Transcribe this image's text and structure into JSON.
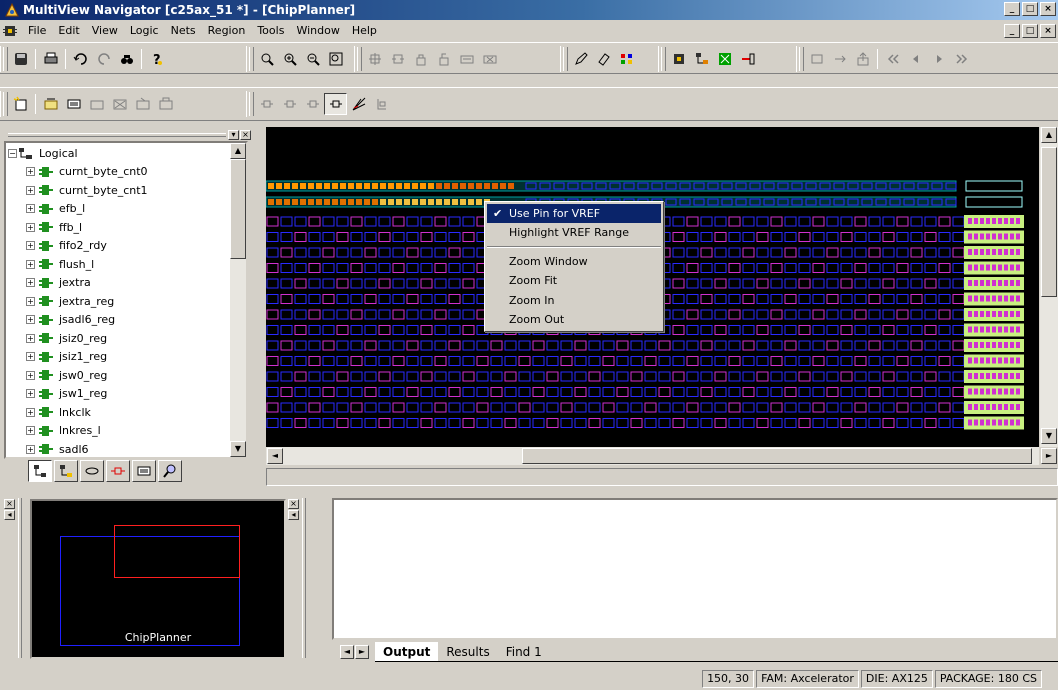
{
  "window": {
    "title": "MultiView Navigator [c25ax_51 *] - [ChipPlanner]",
    "buttons": {
      "minimize": "_",
      "maximize": "□",
      "close": "×"
    }
  },
  "menubar": {
    "items": [
      "File",
      "Edit",
      "View",
      "Logic",
      "Nets",
      "Region",
      "Tools",
      "Window",
      "Help"
    ]
  },
  "tree": {
    "root": "Logical",
    "items": [
      "curnt_byte_cnt0",
      "curnt_byte_cnt1",
      "efb_l",
      "ffb_l",
      "fifo2_rdy",
      "flush_l",
      "jextra",
      "jextra_reg",
      "jsadl6_reg",
      "jsiz0_reg",
      "jsiz1_reg",
      "jsw0_reg",
      "jsw1_reg",
      "lnkclk",
      "lnkres_l",
      "sadl6"
    ]
  },
  "context_menu": {
    "items": [
      {
        "label": "Use Pin for VREF",
        "checked": true,
        "highlighted": true
      },
      {
        "label": "Highlight VREF Range",
        "checked": false,
        "highlighted": false
      },
      {
        "separator": true
      },
      {
        "label": "Zoom Window",
        "checked": false,
        "highlighted": false
      },
      {
        "label": "Zoom Fit",
        "checked": false,
        "highlighted": false
      },
      {
        "label": "Zoom In",
        "checked": false,
        "highlighted": false
      },
      {
        "label": "Zoom Out",
        "checked": false,
        "highlighted": false
      }
    ]
  },
  "navigator": {
    "label": "ChipPlanner"
  },
  "output": {
    "tabs": [
      "Output",
      "Results",
      "Find 1"
    ],
    "active_tab": "Output"
  },
  "status": {
    "coords": "150, 30",
    "family": "FAM: Axcelerator",
    "die": "DIE: AX125",
    "package": "PACKAGE: 180 CS"
  },
  "colors": {
    "title_bar": "#0a246a",
    "cell_blue": "#2a2aff",
    "cell_magenta": "#d030d0",
    "cell_teal": "#00a0a0",
    "io_orange": "#ff9900",
    "io_green": "#c8f080",
    "highlight": "#0a246a"
  }
}
